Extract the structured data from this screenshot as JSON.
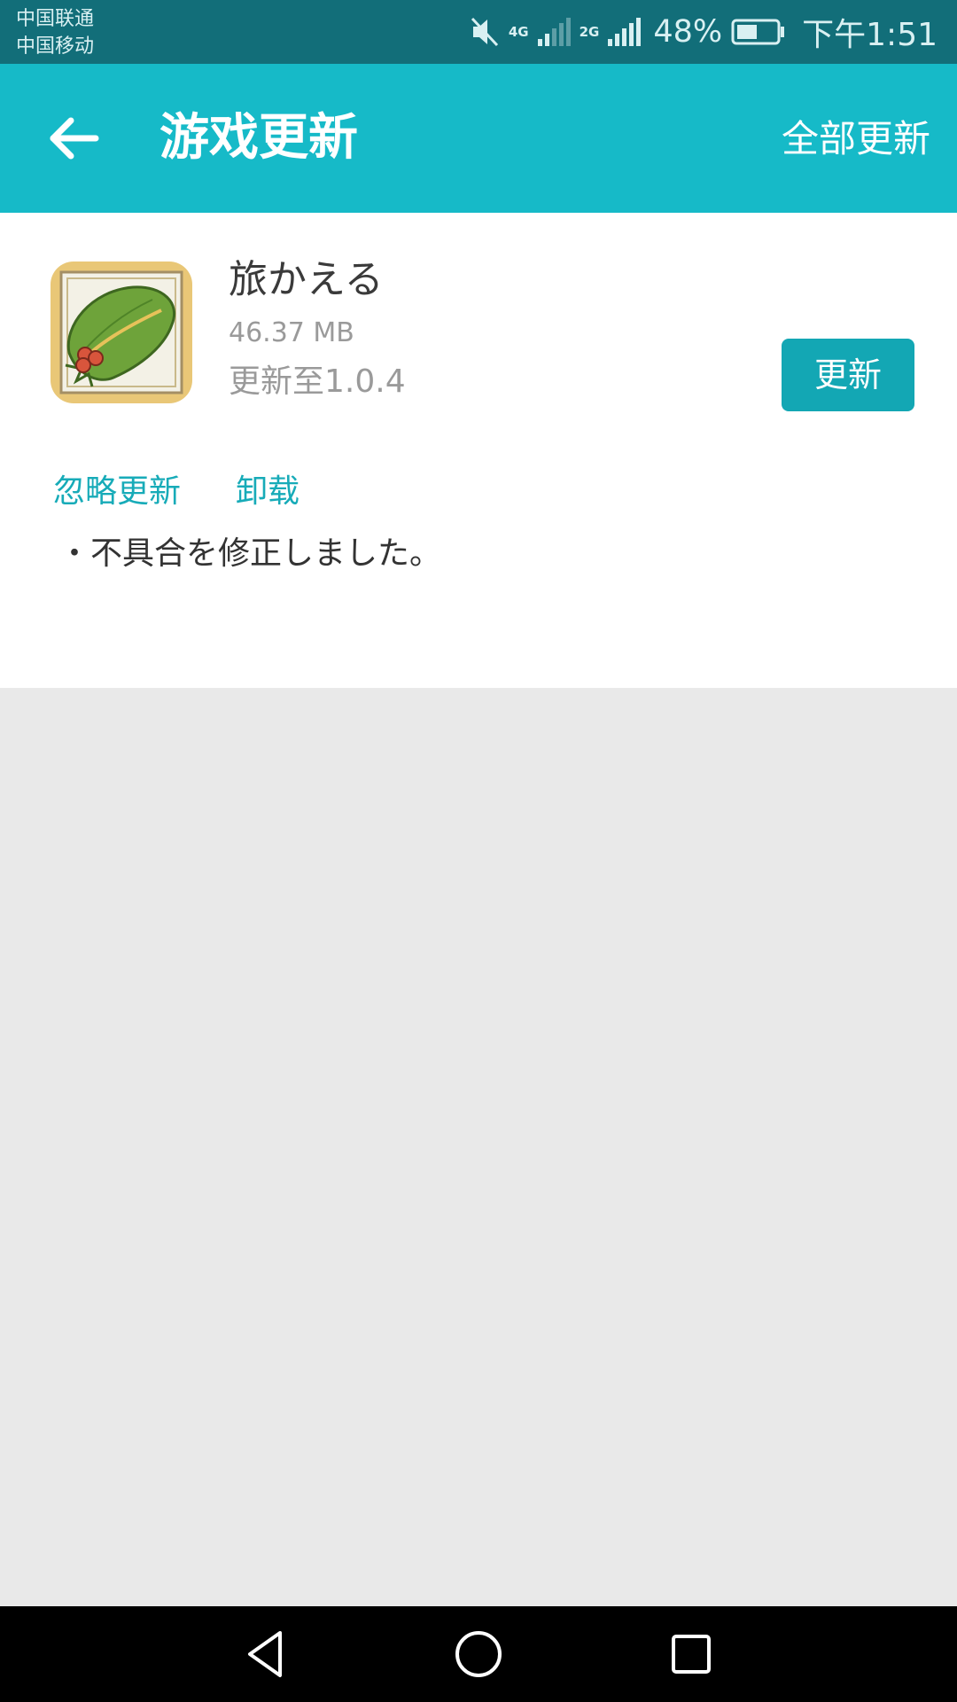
{
  "status_bar": {
    "carrier_1": "中国联通",
    "carrier_2": "中国移动",
    "network_1": "4G",
    "network_2": "2G",
    "battery_percent": "48%",
    "time": "下午1:51",
    "icons": [
      "mute-icon",
      "signal-icon",
      "battery-icon"
    ]
  },
  "app_bar": {
    "title": "游戏更新",
    "update_all": "全部更新",
    "back_icon": "arrow-left-icon",
    "background_color": "#16bac8"
  },
  "update_item": {
    "name": "旅かえる",
    "size": "46.37 MB",
    "version": "更新至1.0.4",
    "update_button": "更新",
    "ignore_link": "忽略更新",
    "uninstall_link": "卸载",
    "release_notes": "・不具合を修正しました。",
    "icon": "frog-hat-app-icon"
  },
  "colors": {
    "accent": "#16bac8",
    "button": "#13a7b4",
    "link": "#17abb8"
  },
  "nav_bar": {
    "icons": [
      "back-triangle-icon",
      "home-circle-icon",
      "recents-square-icon"
    ]
  }
}
